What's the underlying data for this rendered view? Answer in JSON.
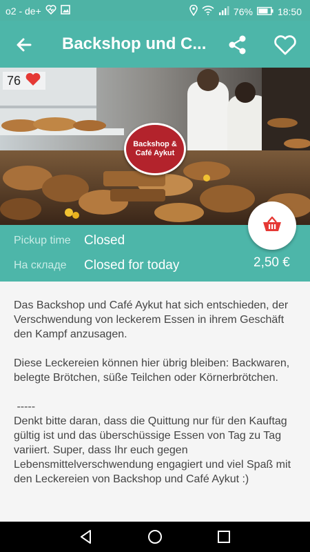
{
  "status_bar": {
    "carrier": "o2 - de+",
    "battery": "76%",
    "time": "18:50"
  },
  "app_bar": {
    "title": "Backshop und C..."
  },
  "hero": {
    "likes": "76",
    "logo_line1": "Backshop &",
    "logo_line2": "Café Aykut"
  },
  "info": {
    "pickup_label": "Pickup time",
    "pickup_value": "Closed",
    "stock_label": "На складе",
    "stock_value": "Closed for today",
    "price": "2,50 €"
  },
  "description": {
    "p1": "Das Backshop und Café Aykut hat sich entschieden, der Verschwendung von leckerem Essen in ihrem Geschäft den Kampf anzusagen.",
    "p2": "Diese Leckereien können hier übrig bleiben: Backwaren, belegte Brötchen, süße Teilchen oder Körnerbrötchen.",
    "separator": " -----",
    "p3": "Denkt bitte daran, dass die Quittung nur für den Kauftag gültig ist und das überschüssige Essen von Tag zu Tag variiert. Super, dass Ihr euch gegen Lebensmittelverschwendung engagiert und viel Spaß mit den Leckereien von Backshop und Café Aykut :)"
  },
  "icons": {
    "back": "arrow-left-icon",
    "share": "share-icon",
    "favorite": "heart-outline-icon",
    "likes": "heart-icon",
    "basket": "basket-icon",
    "nav_back": "triangle-back-icon",
    "nav_home": "circle-home-icon",
    "nav_recent": "square-recent-icon"
  },
  "colors": {
    "primary": "#4db6a9",
    "accent": "#e53935",
    "logo": "#b3232c"
  }
}
